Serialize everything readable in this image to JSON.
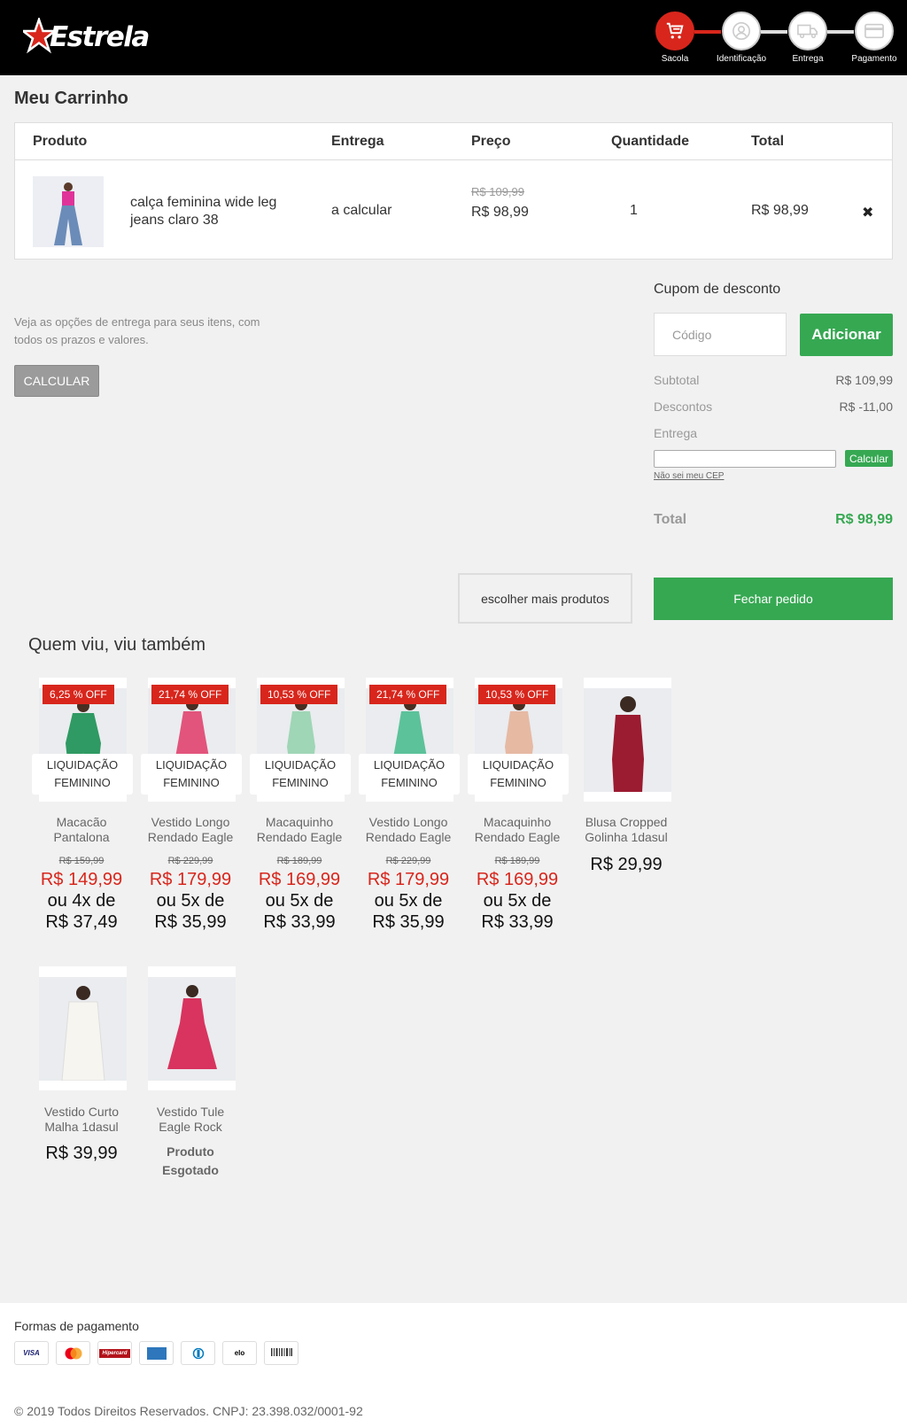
{
  "header": {
    "logo": "Estrela",
    "steps": [
      {
        "label": "Sacola",
        "icon": "cart-icon",
        "active": true
      },
      {
        "label": "Identificação",
        "icon": "user-icon",
        "active": false
      },
      {
        "label": "Entrega",
        "icon": "truck-icon",
        "active": false
      },
      {
        "label": "Pagamento",
        "icon": "card-icon",
        "active": false
      }
    ]
  },
  "page_title": "Meu Carrinho",
  "cart": {
    "columns": [
      "Produto",
      "Entrega",
      "Preço",
      "Quantidade",
      "Total"
    ],
    "item": {
      "name": "calça feminina wide leg jeans claro 38",
      "delivery": "a calcular",
      "old_price": "R$ 109,99",
      "price": "R$ 98,99",
      "quantity": "1",
      "total": "R$ 98,99",
      "remove": "✖"
    }
  },
  "shipping": {
    "info": "Veja as opções de entrega para seus itens, com todos os prazos e valores.",
    "calc_button": "CALCULAR"
  },
  "summary": {
    "coupon_title": "Cupom de desconto",
    "coupon_placeholder": "Código",
    "coupon_button": "Adicionar",
    "subtotal_label": "Subtotal",
    "subtotal": "R$ 109,99",
    "discount_label": "Descontos",
    "discount": "R$ -11,00",
    "delivery_label": "Entrega",
    "cep_button": "Calcular",
    "cep_link": "Não sei meu CEP",
    "total_label": "Total",
    "total": "R$ 98,99"
  },
  "actions": {
    "more_products": "escolher mais produtos",
    "checkout": "Fechar pedido"
  },
  "recommendations": {
    "title": "Quem viu, viu também",
    "products": [
      {
        "badge": "6,25 % OFF",
        "tag1": "LIQUIDAÇÃO",
        "tag2": "FEMININO",
        "name": "Macacão Pantalona",
        "old_price": "R$ 159,99",
        "price": "R$ 149,99",
        "inst1": "ou 4x de",
        "inst2": "R$ 37,49"
      },
      {
        "badge": "21,74 % OFF",
        "tag1": "LIQUIDAÇÃO",
        "tag2": "FEMININO",
        "name": "Vestido Longo Rendado Eagle",
        "old_price": "R$ 229,99",
        "price": "R$ 179,99",
        "inst1": "ou 5x de",
        "inst2": "R$ 35,99"
      },
      {
        "badge": "10,53 % OFF",
        "tag1": "LIQUIDAÇÃO",
        "tag2": "FEMININO",
        "name": "Macaquinho Rendado Eagle",
        "old_price": "R$ 189,99",
        "price": "R$ 169,99",
        "inst1": "ou 5x de",
        "inst2": "R$ 33,99"
      },
      {
        "badge": "21,74 % OFF",
        "tag1": "LIQUIDAÇÃO",
        "tag2": "FEMININO",
        "name": "Vestido Longo Rendado Eagle",
        "old_price": "R$ 229,99",
        "price": "R$ 179,99",
        "inst1": "ou 5x de",
        "inst2": "R$ 35,99"
      },
      {
        "badge": "10,53 % OFF",
        "tag1": "LIQUIDAÇÃO",
        "tag2": "FEMININO",
        "name": "Macaquinho Rendado Eagle",
        "old_price": "R$ 189,99",
        "price": "R$ 169,99",
        "inst1": "ou 5x de",
        "inst2": "R$ 33,99"
      },
      {
        "name": "Blusa Cropped Golinha 1dasul",
        "price": "R$ 29,99"
      },
      {
        "name": "Vestido Curto Malha 1dasul",
        "price": "R$ 39,99"
      },
      {
        "name": "Vestido Tule Eagle Rock",
        "sold_out_1": "Produto",
        "sold_out_2": "Esgotado"
      }
    ]
  },
  "footer": {
    "payment_title": "Formas de pagamento",
    "payment_methods": [
      "VISA",
      "Mastercard",
      "Hipercard",
      "Amex",
      "Diners",
      "elo",
      "Boleto"
    ],
    "copyright": "© 2019 Todos Direitos Reservados. CNPJ: 23.398.032/0001-92"
  },
  "colors": {
    "brand_red": "#d8261c",
    "green": "#36a852",
    "header_bg": "#000000"
  }
}
